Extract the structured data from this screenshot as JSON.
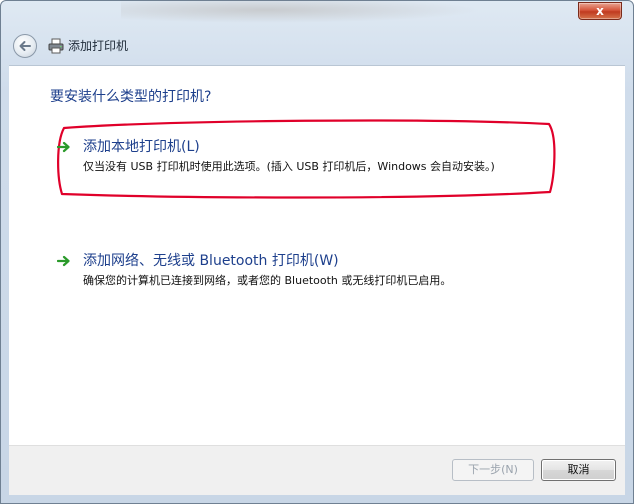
{
  "window": {
    "title": "添加打印机",
    "close_glyph": "x"
  },
  "content": {
    "question": "要安装什么类型的打印机?",
    "options": [
      {
        "title": "添加本地打印机(L)",
        "description": "仅当没有 USB 打印机时使用此选项。(插入 USB 打印机后，Windows 会自动安装。)",
        "highlighted": true
      },
      {
        "title": "添加网络、无线或 Bluetooth 打印机(W)",
        "description": "确保您的计算机已连接到网络，或者您的 Bluetooth 或无线打印机已启用。",
        "highlighted": false
      }
    ]
  },
  "footer": {
    "next_label": "下一步(N)",
    "next_enabled": false,
    "cancel_label": "取消"
  },
  "icons": {
    "back": "back-arrow-icon",
    "printer": "printer-icon",
    "option_arrow": "green-arrow-icon"
  },
  "colors": {
    "accent_text": "#1d3f8c",
    "annotation": "#e0002a",
    "arrow": "#2b9a2b",
    "close": "#c8432a"
  }
}
